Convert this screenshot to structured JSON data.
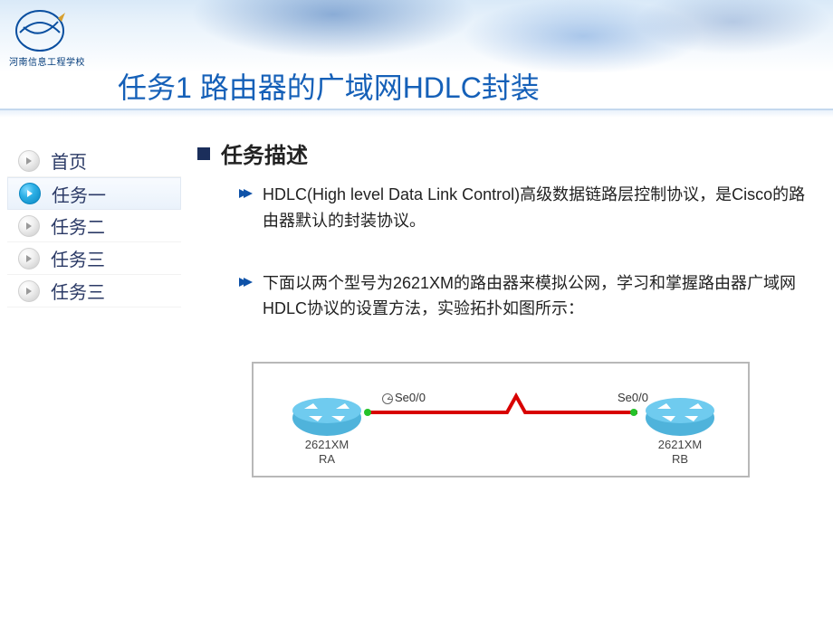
{
  "brand": {
    "school_name": "河南信息工程学校"
  },
  "title": "任务1  路由器的广域网HDLC封装",
  "nav": {
    "items": [
      {
        "label": "首页",
        "icon": "arrow-right-icon",
        "active": false
      },
      {
        "label": "任务一",
        "icon": "arrow-right-icon",
        "active": true
      },
      {
        "label": "任务二",
        "icon": "arrow-right-icon",
        "active": false
      },
      {
        "label": "任务三",
        "icon": "arrow-right-icon",
        "active": false
      },
      {
        "label": "任务三",
        "icon": "arrow-right-icon",
        "active": false
      }
    ]
  },
  "section": {
    "heading": "任务描述",
    "bullets": [
      "HDLC(High level Data Link Control)高级数据链路层控制协议，是Cisco的路由器默认的封装协议。",
      "下面以两个型号为2621XM的路由器来模拟公网，学习和掌握路由器广域网HDLC协议的设置方法，实验拓扑如图所示："
    ]
  },
  "topology": {
    "router_a_model": "2621XM",
    "router_a_name": "RA",
    "router_b_model": "2621XM",
    "router_b_name": "RB",
    "iface_a": "Se0/0",
    "iface_b": "Se0/0",
    "a_has_clock": true
  }
}
